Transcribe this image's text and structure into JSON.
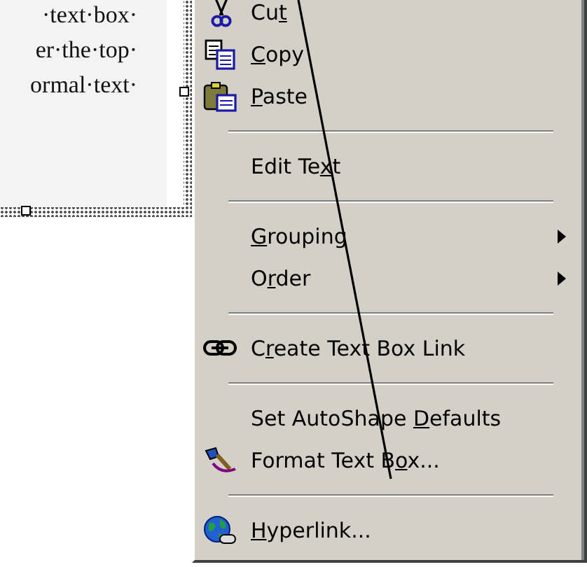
{
  "document": {
    "text_lines": [
      "·text·box·",
      "er·the·top·",
      "ormal·text·"
    ]
  },
  "context_menu": {
    "items": [
      {
        "kind": "item",
        "label": {
          "before": "Cu",
          "accel": "t"
        }
      },
      {
        "kind": "item",
        "label": {
          "accel": "C",
          "after": "opy"
        }
      },
      {
        "kind": "item",
        "label": {
          "accel": "P",
          "after": "aste"
        }
      },
      {
        "kind": "separator"
      },
      {
        "kind": "item",
        "label": {
          "before": "Edit Te",
          "accel": "x",
          "after": "t"
        }
      },
      {
        "kind": "separator"
      },
      {
        "kind": "submenu",
        "label": {
          "accel": "G",
          "after": "rouping"
        }
      },
      {
        "kind": "submenu",
        "label": {
          "before": "O",
          "accel": "r",
          "after": "der"
        }
      },
      {
        "kind": "separator"
      },
      {
        "kind": "item",
        "label": {
          "before": "C",
          "accel": "r",
          "after": "eate Text Box Link"
        }
      },
      {
        "kind": "separator"
      },
      {
        "kind": "item",
        "label": {
          "before": "Set AutoShape ",
          "accel": "D",
          "after": "efaults"
        }
      },
      {
        "kind": "item",
        "label": {
          "before": "Format Text B",
          "accel": "o",
          "after": "x..."
        }
      },
      {
        "kind": "separator"
      },
      {
        "kind": "item",
        "label": {
          "accel": "H",
          "after": "yperlink..."
        }
      }
    ]
  }
}
